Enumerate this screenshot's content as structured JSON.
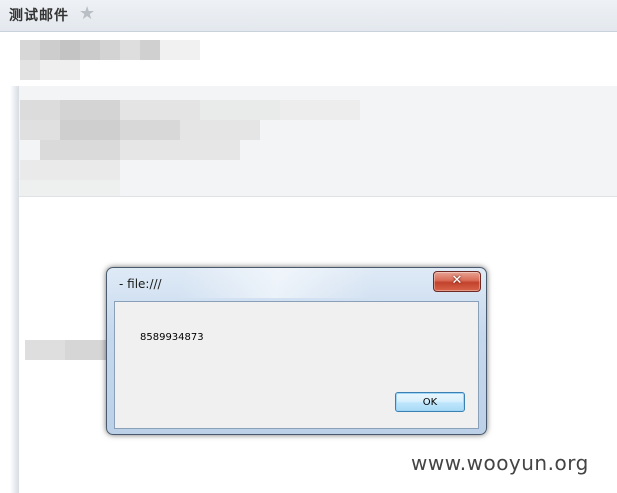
{
  "email": {
    "subject": "测试邮件",
    "star_icon": "star-icon"
  },
  "dialog": {
    "title": "- file:///",
    "message": "8589934873",
    "ok_label": "OK",
    "close_glyph": "✕"
  },
  "watermark": {
    "text": "www.wooyun.org"
  },
  "colors": {
    "close_button": "#d0533b",
    "ok_button_border": "#3c7fb1",
    "dialog_frame": "#c5d8ed"
  }
}
